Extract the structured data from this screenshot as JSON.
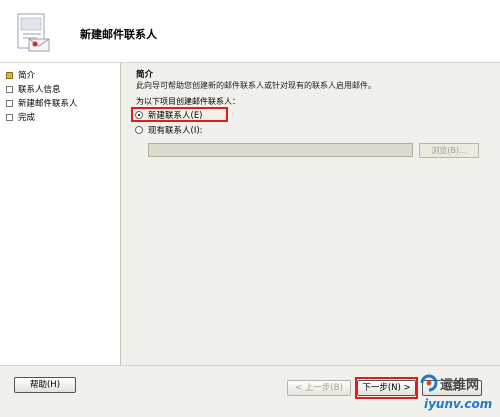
{
  "header": {
    "title": "新建邮件联系人"
  },
  "nav": {
    "items": [
      {
        "label": "简介",
        "active": true
      },
      {
        "label": "联系人信息",
        "active": false
      },
      {
        "label": "新建邮件联系人",
        "active": false
      },
      {
        "label": "完成",
        "active": false
      }
    ]
  },
  "content": {
    "heading": "简介",
    "description": "此向导可帮助您创建新的邮件联系人或针对现有的联系人启用邮件。",
    "prompt": "为以下项目创建邮件联系人：",
    "option_new": "新建联系人(E)",
    "option_existing": "现有联系人(I):",
    "existing_value": "",
    "browse_label": "浏览(B)..."
  },
  "footer": {
    "help_label": "帮助(H)",
    "back_label": "< 上一步(B)",
    "next_label": "下一步(N) >",
    "cancel_label": "取消"
  },
  "watermark": {
    "top": "运维网",
    "bottom": "iyunv.com"
  },
  "colors": {
    "highlight": "#e01c1c",
    "active_bullet": "#d8b642",
    "watermark_blue": "#1d79c9"
  }
}
